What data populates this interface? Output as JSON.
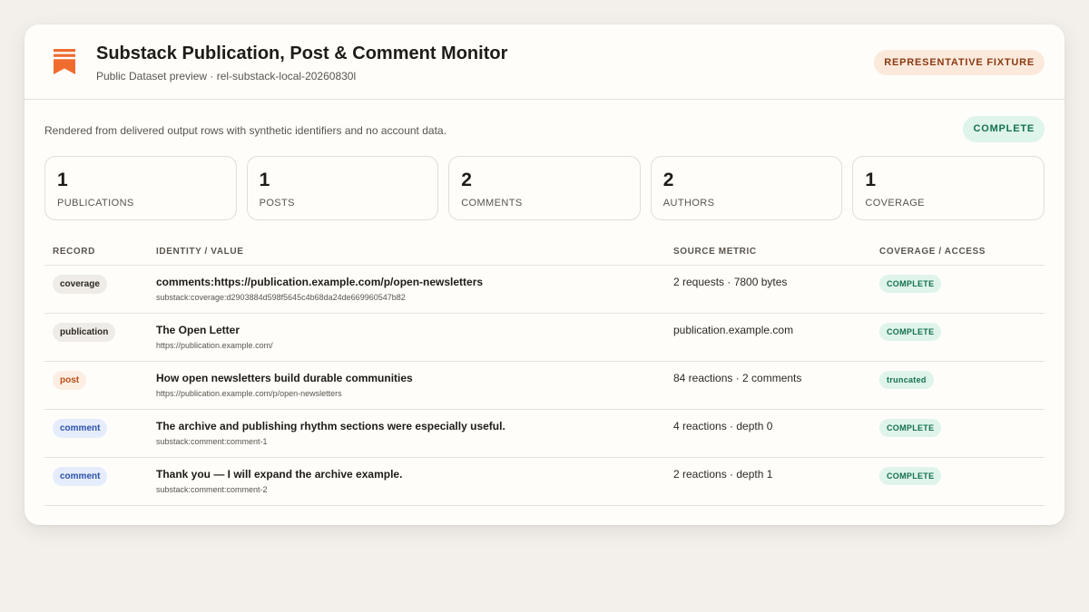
{
  "header": {
    "title": "Substack Publication, Post & Comment Monitor",
    "subtitle": "Public Dataset preview · rel-substack-local-20260830l",
    "fixture_badge": "REPRESENTATIVE FIXTURE",
    "logo_icon": "substack-bookmark-icon",
    "brand_color": "#ef6c2e"
  },
  "summary": {
    "note": "Rendered from delivered output rows with synthetic identifiers and no account data.",
    "status": "COMPLETE"
  },
  "stats": [
    {
      "value": "1",
      "label": "PUBLICATIONS"
    },
    {
      "value": "1",
      "label": "POSTS"
    },
    {
      "value": "2",
      "label": "COMMENTS"
    },
    {
      "value": "2",
      "label": "AUTHORS"
    },
    {
      "value": "1",
      "label": "COVERAGE"
    }
  ],
  "table": {
    "headers": [
      "RECORD",
      "IDENTITY / VALUE",
      "SOURCE METRIC",
      "COVERAGE / ACCESS"
    ],
    "rows": [
      {
        "record": "coverage",
        "record_bg": "#efebe6",
        "record_color": "#2d2822",
        "identity": "comments:https://publication.example.com/p/open-newsletters",
        "identity_sub": "substack:coverage:d2903884d598f5645c4b68da24de669960547b82",
        "metric": "2 requests · 7800 bytes",
        "coverage": "COMPLETE"
      },
      {
        "record": "publication",
        "record_bg": "#efebe6",
        "record_color": "#2d2822",
        "identity": "The Open Letter",
        "identity_sub": "https://publication.example.com/",
        "metric": "publication.example.com",
        "coverage": "COMPLETE"
      },
      {
        "record": "post",
        "record_bg": "#fdeee3",
        "record_color": "#b84d17",
        "identity": "How open newsletters build durable communities",
        "identity_sub": "https://publication.example.com/p/open-newsletters",
        "metric": "84 reactions · 2 comments",
        "coverage": "truncated"
      },
      {
        "record": "comment",
        "record_bg": "#e5ecfb",
        "record_color": "#2c52a8",
        "identity": "The archive and publishing rhythm sections were especially useful.",
        "identity_sub": "substack:comment:comment-1",
        "metric": "4 reactions · depth 0",
        "coverage": "COMPLETE"
      },
      {
        "record": "comment",
        "record_bg": "#e5ecfb",
        "record_color": "#2c52a8",
        "identity": "Thank you — I will expand the archive example.",
        "identity_sub": "substack:comment:comment-2",
        "metric": "2 reactions · depth 1",
        "coverage": "COMPLETE"
      }
    ]
  }
}
